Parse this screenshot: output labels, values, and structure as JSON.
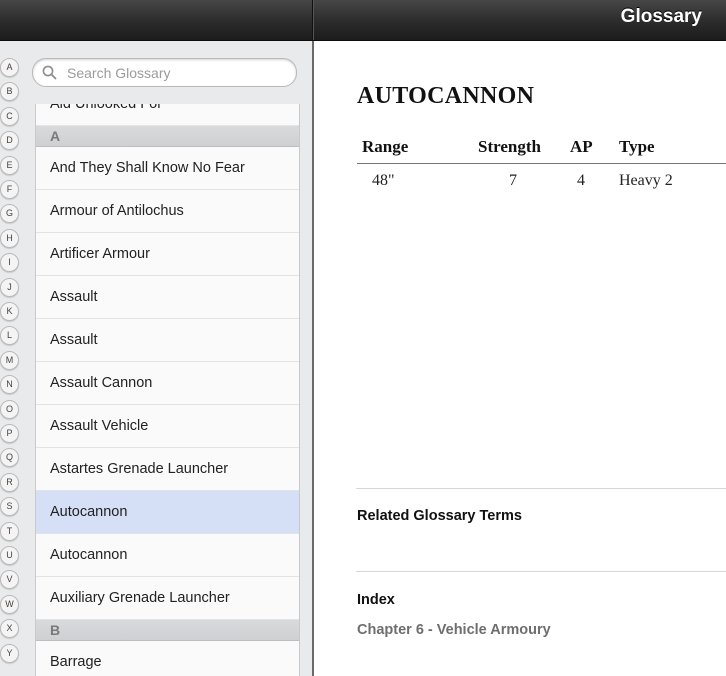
{
  "topbar": {
    "title": "Glossary"
  },
  "search": {
    "placeholder": "Search Glossary",
    "value": ""
  },
  "alphabet": [
    "A",
    "B",
    "C",
    "D",
    "E",
    "F",
    "G",
    "H",
    "I",
    "J",
    "K",
    "L",
    "M",
    "N",
    "O",
    "P",
    "Q",
    "R",
    "S",
    "T",
    "U",
    "V",
    "W",
    "X",
    "Y"
  ],
  "list": {
    "items": [
      {
        "kind": "row",
        "label": "Aid Unlooked For"
      },
      {
        "kind": "header",
        "label": "A"
      },
      {
        "kind": "row",
        "label": "And They Shall Know No Fear"
      },
      {
        "kind": "row",
        "label": "Armour of Antilochus"
      },
      {
        "kind": "row",
        "label": "Artificer Armour"
      },
      {
        "kind": "row",
        "label": "Assault"
      },
      {
        "kind": "row",
        "label": "Assault"
      },
      {
        "kind": "row",
        "label": "Assault Cannon"
      },
      {
        "kind": "row",
        "label": "Assault Vehicle"
      },
      {
        "kind": "row",
        "label": "Astartes Grenade Launcher"
      },
      {
        "kind": "row",
        "label": "Autocannon",
        "selected": true
      },
      {
        "kind": "row",
        "label": "Autocannon"
      },
      {
        "kind": "row",
        "label": "Auxiliary Grenade Launcher"
      },
      {
        "kind": "header",
        "label": "B"
      },
      {
        "kind": "row",
        "label": "Barrage"
      }
    ]
  },
  "detail": {
    "title": "AUTOCANNON",
    "headers": [
      "Range",
      "Strength",
      "AP",
      "Type"
    ],
    "values": [
      "48\"",
      "7",
      "4",
      "Heavy 2"
    ],
    "related_label": "Related Glossary Terms",
    "index_label": "Index",
    "index_link": "Chapter 6 - Vehicle Armoury"
  },
  "colors": {
    "selected_row": "#d5dff5",
    "topbar": "#2b2b2b"
  }
}
